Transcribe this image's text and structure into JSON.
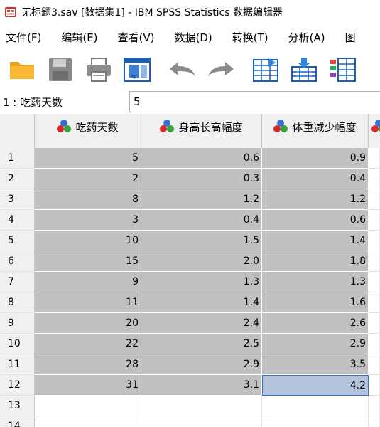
{
  "window": {
    "title": "无标题3.sav [数据集1] - IBM SPSS Statistics 数据编辑器",
    "icon": "spss-app-icon"
  },
  "menu": [
    {
      "label": "文件(F)"
    },
    {
      "label": "编辑(E)"
    },
    {
      "label": "查看(V)"
    },
    {
      "label": "数据(D)"
    },
    {
      "label": "转换(T)"
    },
    {
      "label": "分析(A)"
    },
    {
      "label": "图"
    }
  ],
  "toolbar": [
    {
      "icon": "open-folder-icon"
    },
    {
      "icon": "save-disk-icon"
    },
    {
      "icon": "print-icon"
    },
    {
      "icon": "recall-dialog-icon"
    },
    {
      "icon": "undo-icon"
    },
    {
      "icon": "redo-icon"
    },
    {
      "icon": "go-to-case-icon"
    },
    {
      "icon": "go-to-variable-icon"
    },
    {
      "icon": "variables-icon"
    }
  ],
  "cell_editor": {
    "reference": "1 : 吃药天数",
    "value": "5"
  },
  "columns": [
    {
      "name": "吃药天数",
      "icon": "scale-variable-icon"
    },
    {
      "name": "身高长高幅度",
      "icon": "scale-variable-icon"
    },
    {
      "name": "体重减少幅度",
      "icon": "scale-variable-icon"
    }
  ],
  "rows": [
    {
      "n": "1",
      "cells": [
        "5",
        "0.6",
        "0.9"
      ]
    },
    {
      "n": "2",
      "cells": [
        "2",
        "0.3",
        "0.4"
      ]
    },
    {
      "n": "3",
      "cells": [
        "8",
        "1.2",
        "1.2"
      ]
    },
    {
      "n": "4",
      "cells": [
        "3",
        "0.4",
        "0.6"
      ]
    },
    {
      "n": "5",
      "cells": [
        "10",
        "1.5",
        "1.4"
      ]
    },
    {
      "n": "6",
      "cells": [
        "15",
        "2.0",
        "1.8"
      ]
    },
    {
      "n": "7",
      "cells": [
        "9",
        "1.3",
        "1.3"
      ]
    },
    {
      "n": "8",
      "cells": [
        "11",
        "1.4",
        "1.6"
      ]
    },
    {
      "n": "9",
      "cells": [
        "20",
        "2.4",
        "2.6"
      ]
    },
    {
      "n": "10",
      "cells": [
        "22",
        "2.5",
        "2.9"
      ]
    },
    {
      "n": "11",
      "cells": [
        "28",
        "2.9",
        "3.5"
      ]
    },
    {
      "n": "12",
      "cells": [
        "31",
        "3.1",
        "4.2"
      ]
    },
    {
      "n": "13",
      "cells": [
        "",
        "",
        ""
      ]
    },
    {
      "n": "14",
      "cells": [
        "",
        "",
        ""
      ]
    }
  ],
  "active_cell": {
    "row": "12",
    "column": "体重减少幅度"
  }
}
